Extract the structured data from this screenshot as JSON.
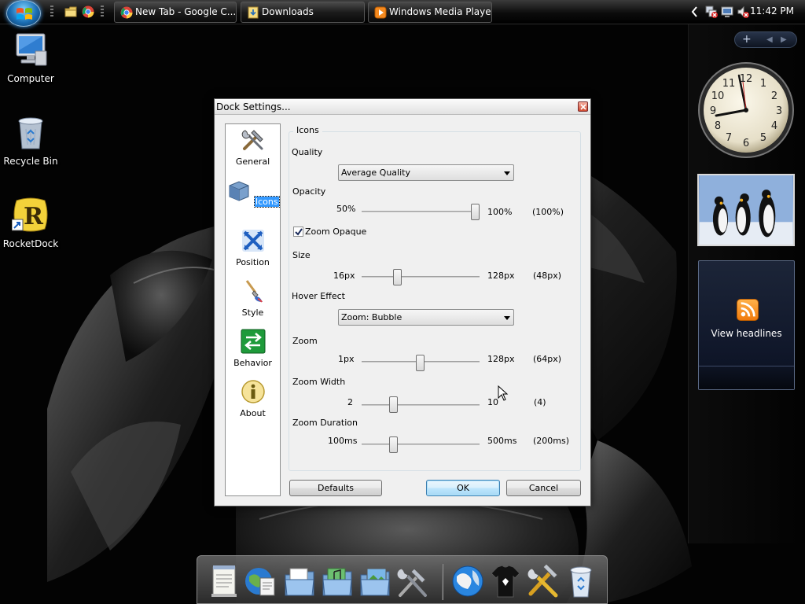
{
  "taskbar": {
    "buttons": [
      {
        "label": "New Tab - Google C..."
      },
      {
        "label": "Downloads"
      },
      {
        "label": "Windows Media Player"
      }
    ],
    "clock": "11:42 PM",
    "tray_icons": [
      "chevron-left-icon",
      "network-error-icon",
      "display-icon",
      "volume-muted-icon"
    ]
  },
  "desktop": {
    "icons": [
      {
        "label": "Computer",
        "icon": "computer-icon"
      },
      {
        "label": "Recycle Bin",
        "icon": "recycle-bin-icon"
      },
      {
        "label": "RocketDock",
        "icon": "rocketdock-icon"
      }
    ]
  },
  "sidebar": {
    "controls": [
      "+",
      "◀",
      "▶"
    ],
    "feed_label": "View headlines"
  },
  "dialog": {
    "title": "Dock Settings...",
    "nav": [
      {
        "label": "General",
        "icon": "tools-icon",
        "selected": false
      },
      {
        "label": "Icons",
        "icon": "icons-box-icon",
        "selected": true
      },
      {
        "label": "Position",
        "icon": "position-arrows-icon",
        "selected": false
      },
      {
        "label": "Style",
        "icon": "paintbrush-icon",
        "selected": false
      },
      {
        "label": "Behavior",
        "icon": "behavior-arrows-icon",
        "selected": false
      },
      {
        "label": "About",
        "icon": "info-icon",
        "selected": false
      }
    ],
    "group_title": "Icons",
    "quality": {
      "label": "Quality",
      "value": "Average Quality"
    },
    "opacity": {
      "label": "Opacity",
      "min": "50%",
      "max": "100%",
      "current": "(100%)",
      "fraction": 1.0
    },
    "zoom_opaque": {
      "label": "Zoom Opaque",
      "checked": true
    },
    "size": {
      "label": "Size",
      "min": "16px",
      "max": "128px",
      "current": "(48px)",
      "fraction": 0.286
    },
    "hover_effect": {
      "label": "Hover Effect",
      "value": "Zoom: Bubble"
    },
    "zoom": {
      "label": "Zoom",
      "min": "1px",
      "max": "128px",
      "current": "(64px)",
      "fraction": 0.496
    },
    "zoom_width": {
      "label": "Zoom Width",
      "min": "2",
      "max": "10",
      "current": "(4)",
      "fraction": 0.25
    },
    "zoom_duration": {
      "label": "Zoom Duration",
      "min": "100ms",
      "max": "500ms",
      "current": "(200ms)",
      "fraction": 0.25
    },
    "buttons": {
      "defaults": "Defaults",
      "ok": "OK",
      "cancel": "Cancel"
    }
  },
  "dock": {
    "icons": [
      "notepad-icon",
      "globe-document-icon",
      "documents-folder-icon",
      "music-folder-icon",
      "pictures-folder-icon",
      "tools-icon",
      "globe-icon",
      "tshirt-icon",
      "hammer-wrench-icon",
      "recycle-bin-icon"
    ]
  }
}
